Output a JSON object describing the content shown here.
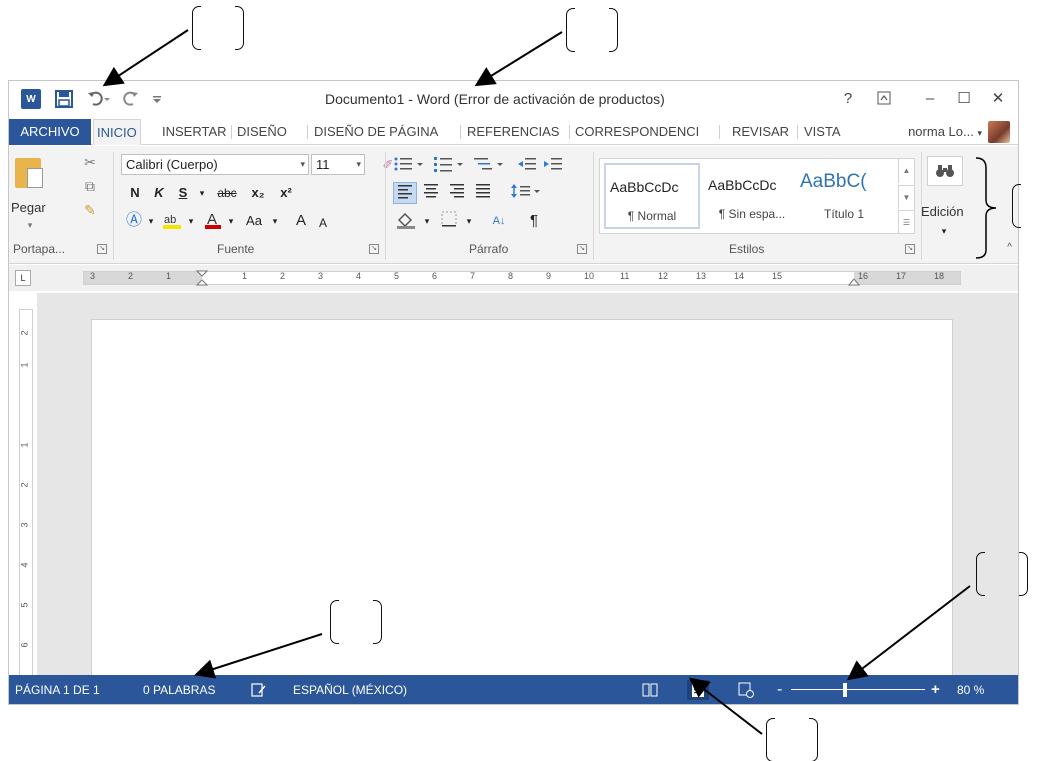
{
  "app": {
    "title": "Documento1 - Word (Error de activación de productos)",
    "word_logo": "W",
    "accent_color": "#2b579a"
  },
  "quick_access": {
    "icons": [
      "word-logo-icon",
      "save-icon",
      "undo-icon",
      "redo-icon",
      "customize-icon"
    ]
  },
  "window_controls": {
    "help": "?",
    "ribbon_display": "⊼",
    "minimize": "–",
    "maximize": "☐",
    "close": "✕"
  },
  "tabs": [
    {
      "label": "ARCHIVO"
    },
    {
      "label": "INICIO"
    },
    {
      "label": "INSERTAR"
    },
    {
      "label": "DISEÑO"
    },
    {
      "label": "DISEÑO DE PÁGINA"
    },
    {
      "label": "REFERENCIAS"
    },
    {
      "label": "CORRESPONDENCI"
    },
    {
      "label": "REVISAR"
    },
    {
      "label": "VISTA"
    }
  ],
  "user": {
    "name": "norma Lo..."
  },
  "ribbon": {
    "clipboard": {
      "paste_label": "Pegar",
      "group_label": "Portapa..."
    },
    "font": {
      "family": "Calibri (Cuerpo)",
      "size": "11",
      "bold": "N",
      "italic": "K",
      "underline": "S",
      "strike": "abc",
      "subscript": "x₂",
      "superscript": "x²",
      "change_case": "Aa",
      "grow": "A",
      "shrink": "A",
      "group_label": "Fuente",
      "highlight_color": "#f4e400",
      "font_color": "#d00000"
    },
    "paragraph": {
      "group_label": "Párrafo",
      "pilcrow": "¶",
      "sort": "A↓"
    },
    "styles": {
      "group_label": "Estilos",
      "items": [
        {
          "sample": "AaBbCcDc",
          "name": "¶ Normal"
        },
        {
          "sample": "AaBbCcDc",
          "name": "¶ Sin espa..."
        },
        {
          "sample": "AaBbC(",
          "name": "Título 1"
        }
      ]
    },
    "editing": {
      "label": "Edición"
    }
  },
  "ruler": {
    "corner": "L",
    "numbers": [
      "3",
      "2",
      "1",
      "1",
      "2",
      "3",
      "4",
      "5",
      "6",
      "7",
      "8",
      "9",
      "10",
      "11",
      "12",
      "13",
      "14",
      "15",
      "16",
      "17",
      "18"
    ],
    "vertical_numbers": [
      "2",
      "1",
      "1",
      "2",
      "3",
      "4",
      "5",
      "6"
    ]
  },
  "statusbar": {
    "page": "PÁGINA 1 DE 1",
    "words": "0 PALABRAS",
    "language": "ESPAÑOL (MÉXICO)",
    "zoom_minus": "-",
    "zoom_plus": "+",
    "zoom_level": "80 %",
    "zoom_fraction": 0.4
  }
}
